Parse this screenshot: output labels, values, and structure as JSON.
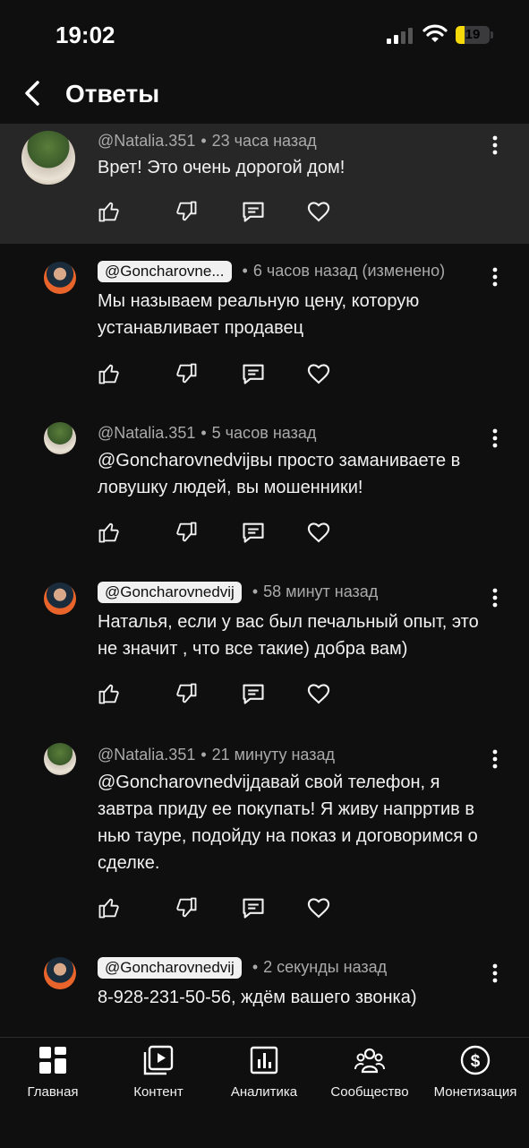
{
  "status_bar": {
    "time": "19:02",
    "battery": "19"
  },
  "header": {
    "title": "Ответы"
  },
  "comments": [
    {
      "author": "@Natalia.351",
      "time": "23 часа назад",
      "text": "Врет! Это очень дорогой дом!"
    },
    {
      "author": "@Goncharovne...",
      "time": "6 часов назад (изменено)",
      "text": "Мы называем реальную цену, которую устанавливает продавец"
    },
    {
      "author": "@Natalia.351",
      "time": "5 часов назад",
      "text": "@Goncharovnedvijвы просто заманиваете в ловушку людей, вы мошенники!"
    },
    {
      "author": "@Goncharovnedvij",
      "time": "58 минут назад",
      "text": "Наталья, если у вас был печальный опыт, это не значит , что все такие) добра вам)"
    },
    {
      "author": "@Natalia.351",
      "time": "21 минуту назад",
      "text": "@Goncharovnedvijдавай свой телефон, я завтра приду ее покупать! Я живу напрртив в нью тауре, подойду на показ и договоримся о сделке."
    },
    {
      "author": "@Goncharovnedvij",
      "time": "2 секунды назад",
      "text": "8-928-231-50-56, ждём вашего звонка)"
    }
  ],
  "tabs": [
    {
      "label": "Главная",
      "icon": "home-grid-icon"
    },
    {
      "label": "Контент",
      "icon": "content-play-icon"
    },
    {
      "label": "Аналитика",
      "icon": "analytics-chart-icon"
    },
    {
      "label": "Сообщество",
      "icon": "community-people-icon"
    },
    {
      "label": "Монетизация",
      "icon": "monetization-dollar-icon"
    }
  ],
  "colors": {
    "background": "#0f0f0f",
    "highlight": "#272727",
    "text": "#f1f1f1",
    "secondary": "#aaaaaa",
    "battery": "#f5d90a"
  }
}
